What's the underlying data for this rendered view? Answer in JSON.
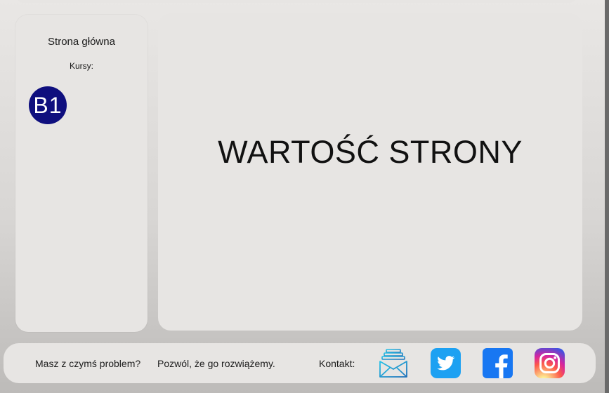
{
  "sidebar": {
    "home_label": "Strona główna",
    "courses_label": "Kursy:",
    "course_badge": "B1"
  },
  "main": {
    "value_text": "WARTOŚĆ STRONY"
  },
  "footer": {
    "problem_text": "Masz z czymś problem?",
    "solve_text": "Pozwól, że go rozwiążemy.",
    "contact_label": "Kontakt:",
    "icons": [
      "mail-icon",
      "twitter-icon",
      "facebook-icon",
      "instagram-icon"
    ]
  },
  "colors": {
    "badge": "#0f0f7e",
    "twitter": "#1da1f2",
    "facebook": "#1877f2"
  }
}
